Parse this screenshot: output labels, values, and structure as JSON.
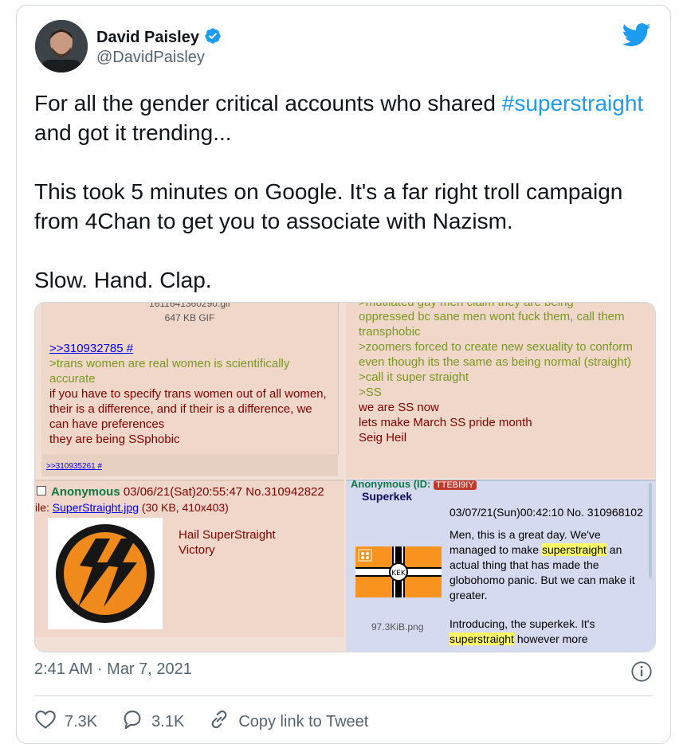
{
  "author": {
    "name": "David Paisley",
    "handle": "@DavidPaisley"
  },
  "tweet": {
    "line1_pre": "For all the gender critical accounts who shared ",
    "hashtag": "#superstraight",
    "line1_post": "and got it trending...",
    "para2": "This took 5 minutes on Google. It's a far right troll campaign from 4Chan to get you to associate with Nazism.",
    "para3": "Slow. Hand. Clap."
  },
  "media": {
    "p1": {
      "top_cut": "1611641360290.gif",
      "filesize": "647 KB GIF",
      "reply_link": ">>310932785 #",
      "quote": ">trans women are real women is scientifically accurate",
      "body": "if you have to specify trans women out of all women, their is a difference, and if their is a difference, we can have preferences",
      "body2": "they are being SSphobic",
      "footer_link": ">>310935261 #"
    },
    "p2": {
      "top_cut": ">mutilated gay men claim they are being",
      "q1": "oppressed bc sane men wont fuck them, call them transphobic",
      "q2": ">zoomers forced to create new sexuality to conform even though its the same as being normal (straight)",
      "q3": ">call it super straight",
      "q4": ">SS",
      "r1": "we are SS now",
      "r2": "lets make March SS pride month",
      "r3": "Seig Heil"
    },
    "p3": {
      "poster": "Anonymous",
      "datetime": "03/06/21(Sat)20:55:47 No.310942822",
      "file_prefix": "ile: ",
      "file_link": "SuperStraight.jpg",
      "file_info": " (30 KB, 410x403)",
      "text1": "Hail SuperStraight",
      "text2": "Victory"
    },
    "p4": {
      "poster_cut": "Anonymous (ID: ",
      "id_badge": "TTEBI9IY",
      "subject": "Superkek",
      "datetime": "03/07/21(Sun)00:42:10 No. 310968102",
      "msg1_pre": "Men, this is a great day. We've managed to make ",
      "msg1_hl": "superstraight",
      "msg1_post": " an actual thing that has made the globohomo panic. But we can make it greater.",
      "filesize": "97.3KiB.png",
      "msg2_pre": "Introducing, the superkek. It's ",
      "msg2_hl": "superstraight",
      "msg2_post": " however more"
    }
  },
  "footer": {
    "timestamp": "2:41 AM · Mar 7, 2021",
    "likes": "7.3K",
    "replies": "3.1K",
    "copy_link": "Copy link to Tweet"
  },
  "colors": {
    "accent": "#1d9bf0",
    "verified": "#1d9bf0",
    "greentext": "#789922",
    "chan_red": "#800000"
  },
  "icons": [
    "verified-badge-icon",
    "twitter-bird-icon",
    "info-icon",
    "heart-icon",
    "reply-icon",
    "link-icon"
  ]
}
